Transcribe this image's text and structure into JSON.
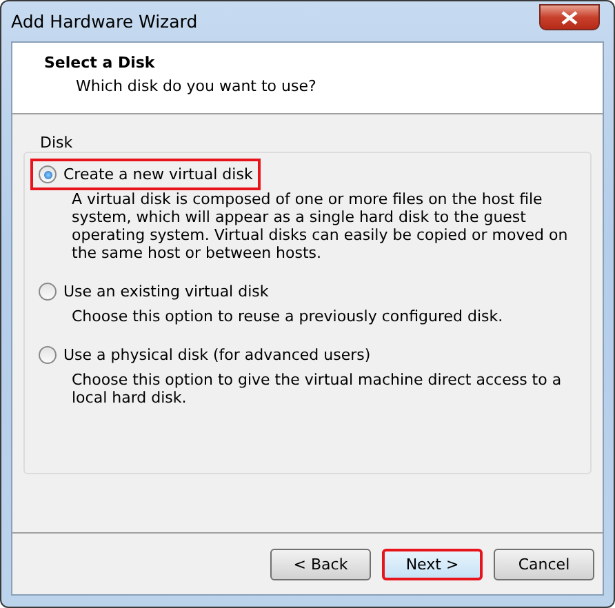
{
  "window": {
    "title": "Add Hardware Wizard"
  },
  "header": {
    "title": "Select a Disk",
    "subtitle": "Which disk do you want to use?"
  },
  "group": {
    "label": "Disk",
    "options": [
      {
        "label": "Create a new virtual disk",
        "description": "A virtual disk is composed of one or more files on the host file system, which will appear as a single hard disk to the guest operating system. Virtual disks can easily be copied or moved on the same host or between hosts.",
        "selected": true,
        "highlighted": true
      },
      {
        "label": "Use an existing virtual disk",
        "description": "Choose this option to reuse a previously configured disk.",
        "selected": false,
        "highlighted": false
      },
      {
        "label": "Use a physical disk (for advanced users)",
        "description": "Choose this option to give the virtual machine direct access to a local hard disk.",
        "selected": false,
        "highlighted": false
      }
    ]
  },
  "buttons": [
    {
      "label": "< Back",
      "highlighted": false
    },
    {
      "label": "Next >",
      "highlighted": true
    },
    {
      "label": "Cancel",
      "highlighted": false
    }
  ]
}
